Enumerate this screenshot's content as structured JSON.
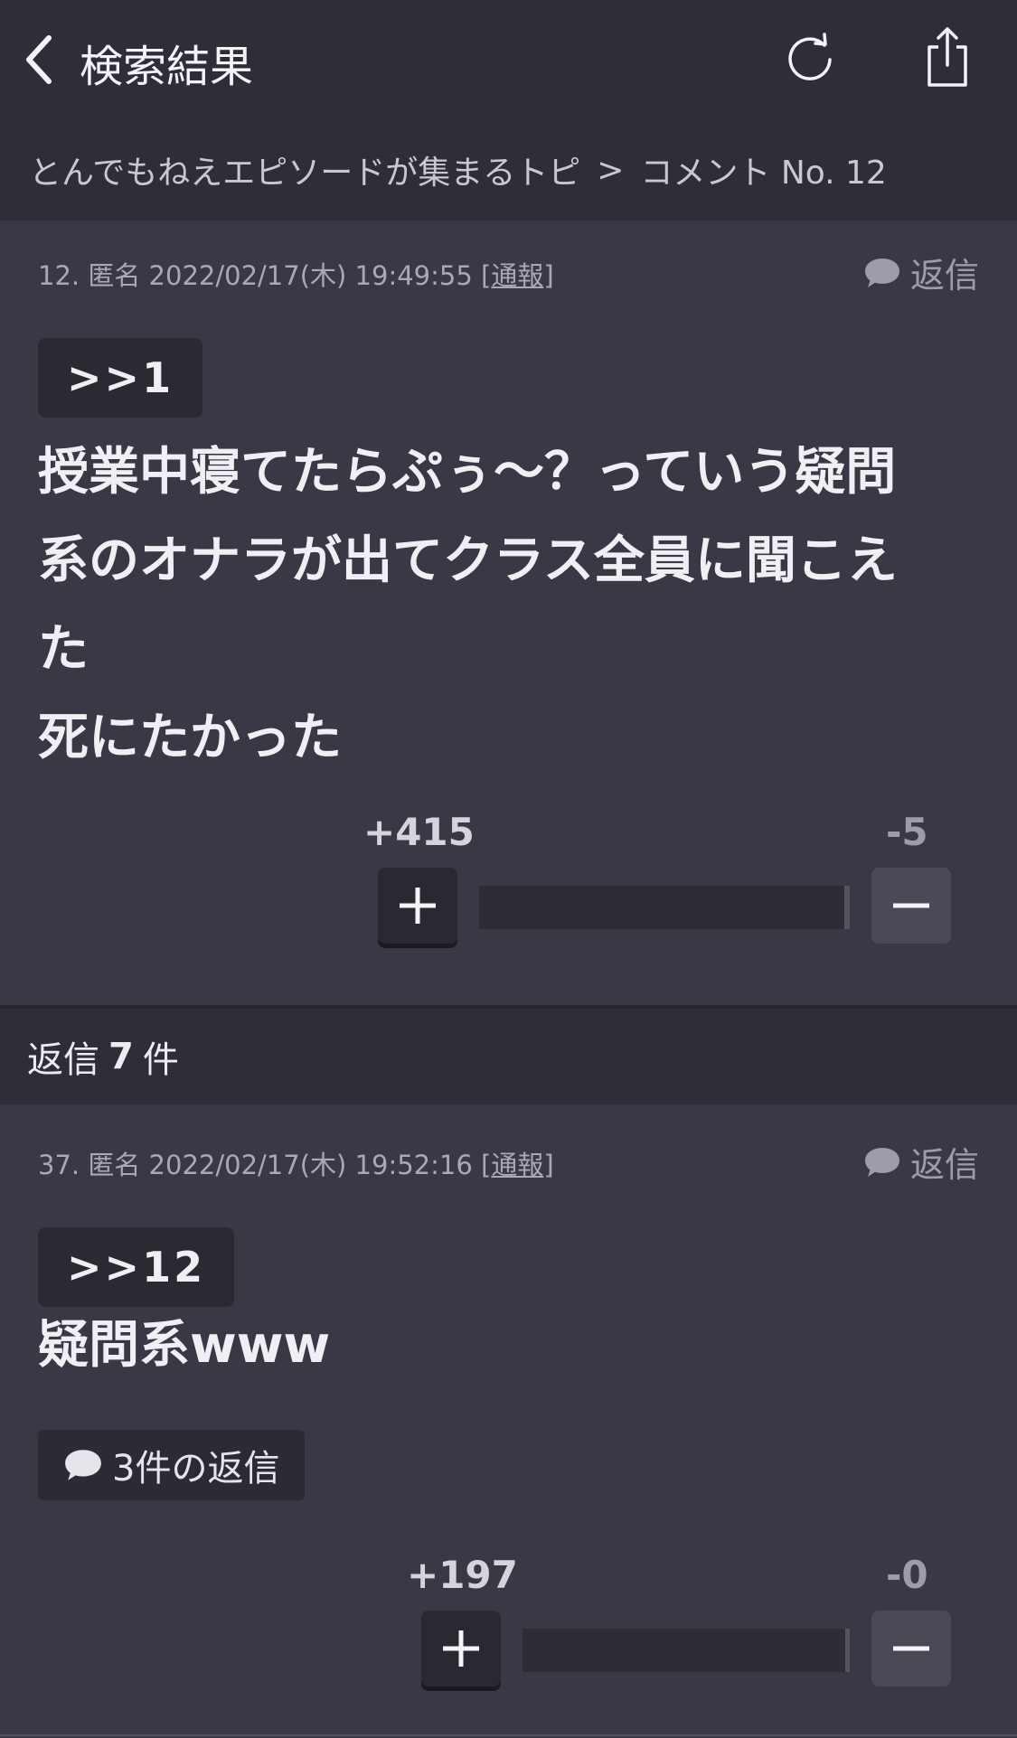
{
  "nav": {
    "title": "検索結果",
    "back_icon": "chevron-left-icon",
    "refresh_icon": "refresh-icon",
    "share_icon": "share-icon"
  },
  "breadcrumb": {
    "topic": "とんでもねえエピソードが集まるトピ",
    "separator": ">",
    "current": "コメント No. 12"
  },
  "comments": [
    {
      "meta": "12. 匿名 2022/02/17(木) 19:49:55 [",
      "report": "通報",
      "meta_end": "]",
      "reply_label": "返信",
      "anchor": ">>1",
      "body": "授業中寝てたらぷぅ〜？っていう疑問\n系のオナラが出てクラス全員に聞こえ\nた\n死にたかった",
      "plus": "+415",
      "minus": "-5",
      "plus_ratio": 0.988
    },
    {
      "meta": "37. 匿名 2022/02/17(木) 19:52:16 [",
      "report": "通報",
      "meta_end": "]",
      "reply_label": "返信",
      "anchor": ">>12",
      "body": "疑問系www",
      "thread_label": "3件の返信",
      "plus": "+197",
      "minus": "-0",
      "plus_ratio": 0.99
    }
  ],
  "replies_header": {
    "prefix": "返信",
    "count": "7",
    "suffix": "件"
  },
  "colors": {
    "background": "#3a3845",
    "header": "#2f2e38",
    "text": "#ececf1"
  }
}
